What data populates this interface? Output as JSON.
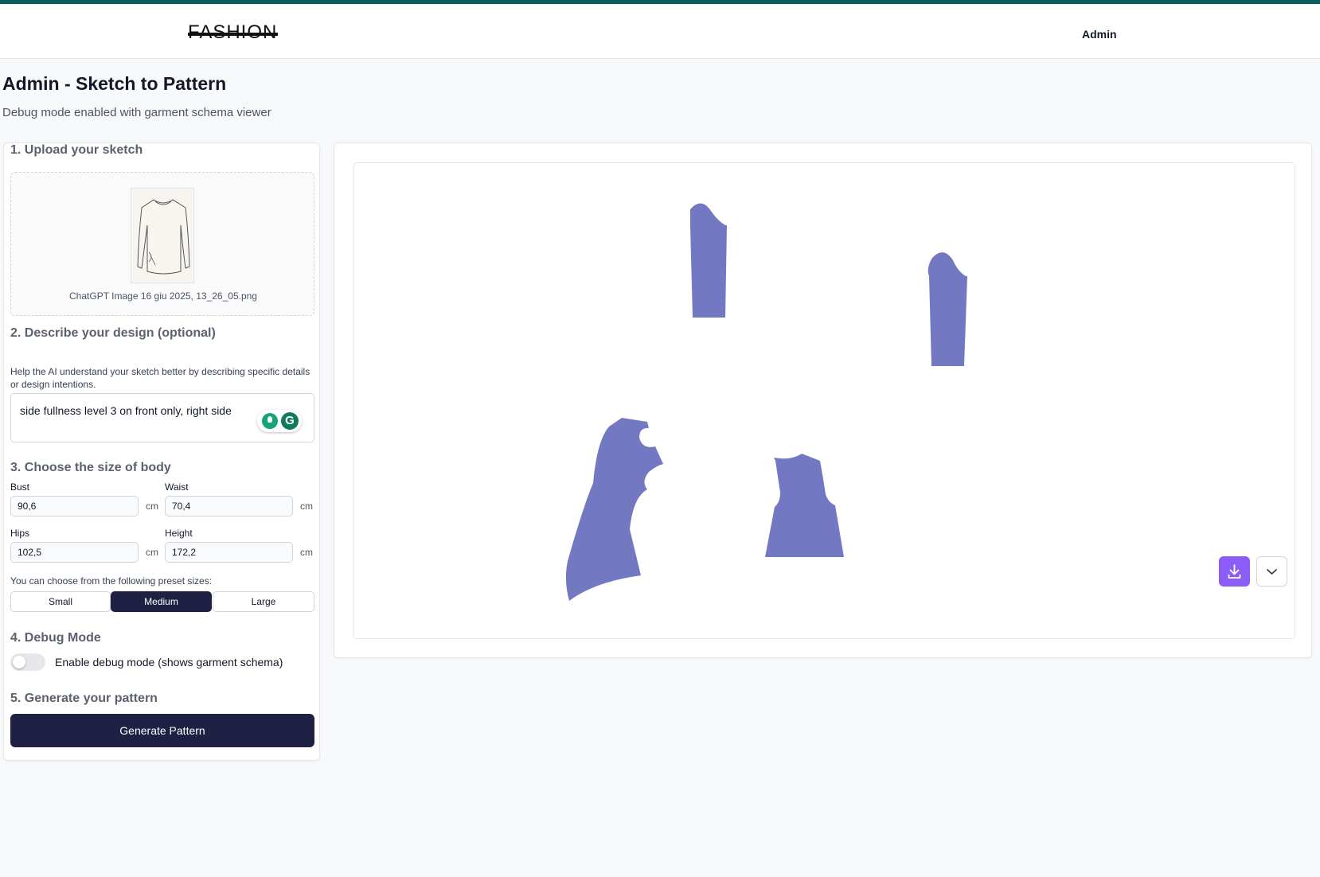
{
  "header": {
    "logo": "FASHION",
    "nav_admin": "Admin"
  },
  "page": {
    "title": "Admin - Sketch to Pattern",
    "subtitle": "Debug mode enabled with garment schema viewer"
  },
  "upload": {
    "title": "1. Upload your sketch",
    "filename": "ChatGPT Image 16 giu 2025, 13_26_05.png"
  },
  "describe": {
    "title": "2. Describe your design (optional)",
    "help": "Help the AI understand your sketch better by describing specific details or design intentions.",
    "value": "side fullness level 3 on front only, right side"
  },
  "size": {
    "title": "3. Choose the size of body",
    "bust_label": "Bust",
    "bust_value": "90,6",
    "waist_label": "Waist",
    "waist_value": "70,4",
    "hips_label": "Hips",
    "hips_value": "102,5",
    "height_label": "Height",
    "height_value": "172,2",
    "unit": "cm",
    "preset_hint": "You can choose from the following preset sizes:",
    "presets": [
      "Small",
      "Medium",
      "Large"
    ],
    "selected_preset": "Medium"
  },
  "debug": {
    "title": "4. Debug Mode",
    "toggle_label": "Enable debug mode (shows garment schema)",
    "enabled": false
  },
  "generate": {
    "title": "5. Generate your pattern",
    "button": "Generate Pattern"
  },
  "viewer": {
    "piece_color": "#7378c2",
    "accent_color": "#8b5cf6",
    "icons": [
      "download-icon",
      "chevron-down-icon"
    ]
  }
}
